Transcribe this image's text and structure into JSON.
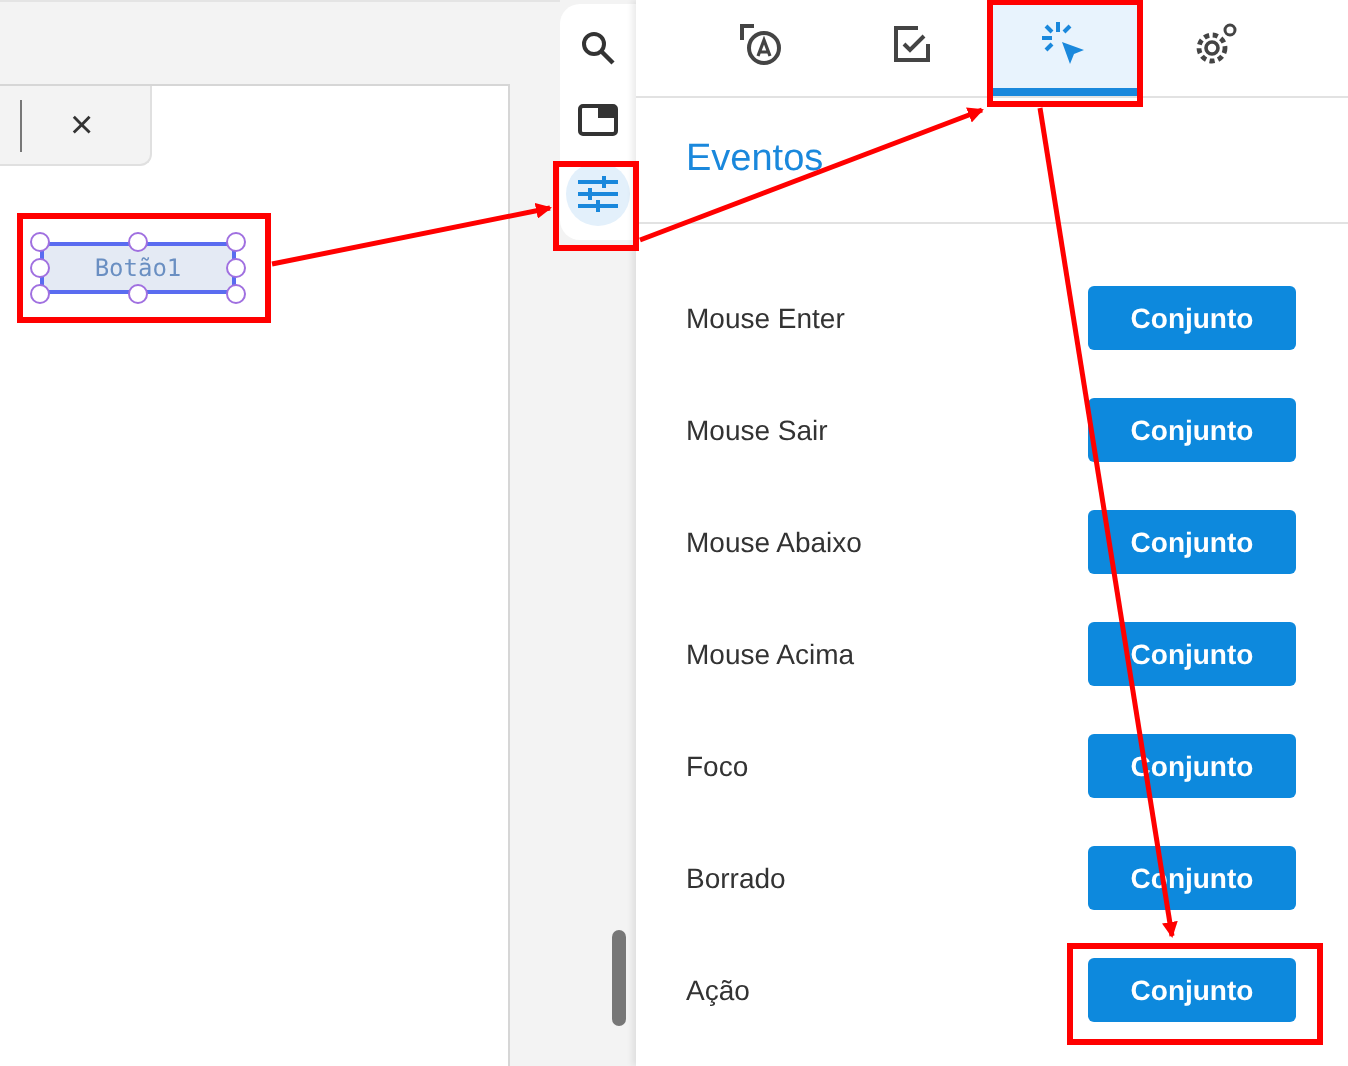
{
  "editor_tab": {
    "close": "×"
  },
  "canvas": {
    "widget": {
      "label": "Botão1",
      "selected": true
    }
  },
  "tool_strip": [
    {
      "kind": "search",
      "selected": false
    },
    {
      "kind": "panel",
      "selected": false
    },
    {
      "kind": "sliders",
      "selected": true
    }
  ],
  "tabs": [
    {
      "kind": "text",
      "selected": false
    },
    {
      "kind": "check",
      "selected": false
    },
    {
      "kind": "click",
      "selected": true
    },
    {
      "kind": "settings",
      "selected": false
    }
  ],
  "heading": "Eventos",
  "events": [
    {
      "label": "Mouse Enter",
      "button": "Conjunto"
    },
    {
      "label": "Mouse Sair",
      "button": "Conjunto"
    },
    {
      "label": "Mouse Abaixo",
      "button": "Conjunto"
    },
    {
      "label": "Mouse Acima",
      "button": "Conjunto"
    },
    {
      "label": "Foco",
      "button": "Conjunto"
    },
    {
      "label": "Borrado",
      "button": "Conjunto"
    },
    {
      "label": "Ação",
      "button": "Conjunto"
    }
  ]
}
